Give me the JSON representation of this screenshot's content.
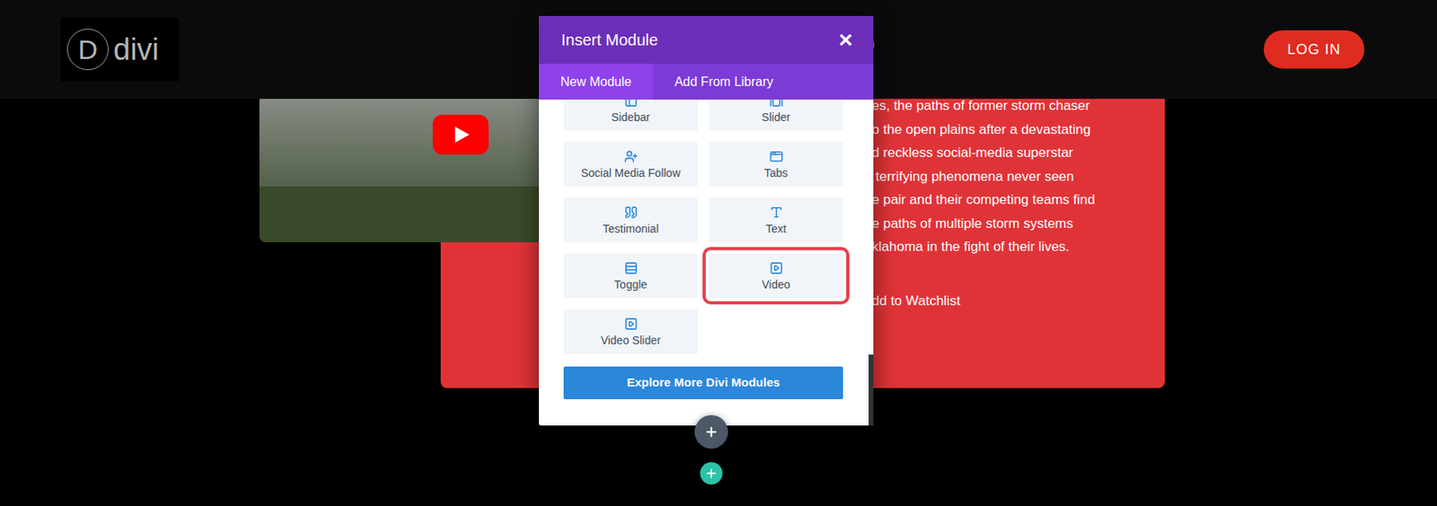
{
  "header": {
    "logo": {
      "mark": "D",
      "text": "divi"
    },
    "nav": [
      "n"
    ],
    "login_button": "LOG IN"
  },
  "card": {
    "lines": [
      "es, the paths of former storm chaser",
      "o the open plains after a devastating",
      "d reckless social-media superstar",
      " terrifying phenomena never seen",
      "e pair and their competing teams find",
      "e paths of multiple storm systems",
      "klahoma in the fight of their lives."
    ],
    "watchlist": "dd to Watchlist"
  },
  "modal": {
    "title": "Insert Module",
    "close": "×",
    "tabs": [
      {
        "label": "New Module",
        "selected": true
      },
      {
        "label": "Add From Library",
        "selected": false
      }
    ],
    "modules": [
      {
        "label": "Sidebar",
        "highlighted": false
      },
      {
        "label": "Slider",
        "highlighted": false
      },
      {
        "label": "Social Media Follow",
        "highlighted": false
      },
      {
        "label": "Tabs",
        "highlighted": false
      },
      {
        "label": "Testimonial",
        "highlighted": false
      },
      {
        "label": "Text",
        "highlighted": false
      },
      {
        "label": "Toggle",
        "highlighted": false
      },
      {
        "label": "Video",
        "highlighted": true
      },
      {
        "label": "Video Slider",
        "highlighted": false
      }
    ],
    "explore_button": "Explore More Divi Modules"
  }
}
